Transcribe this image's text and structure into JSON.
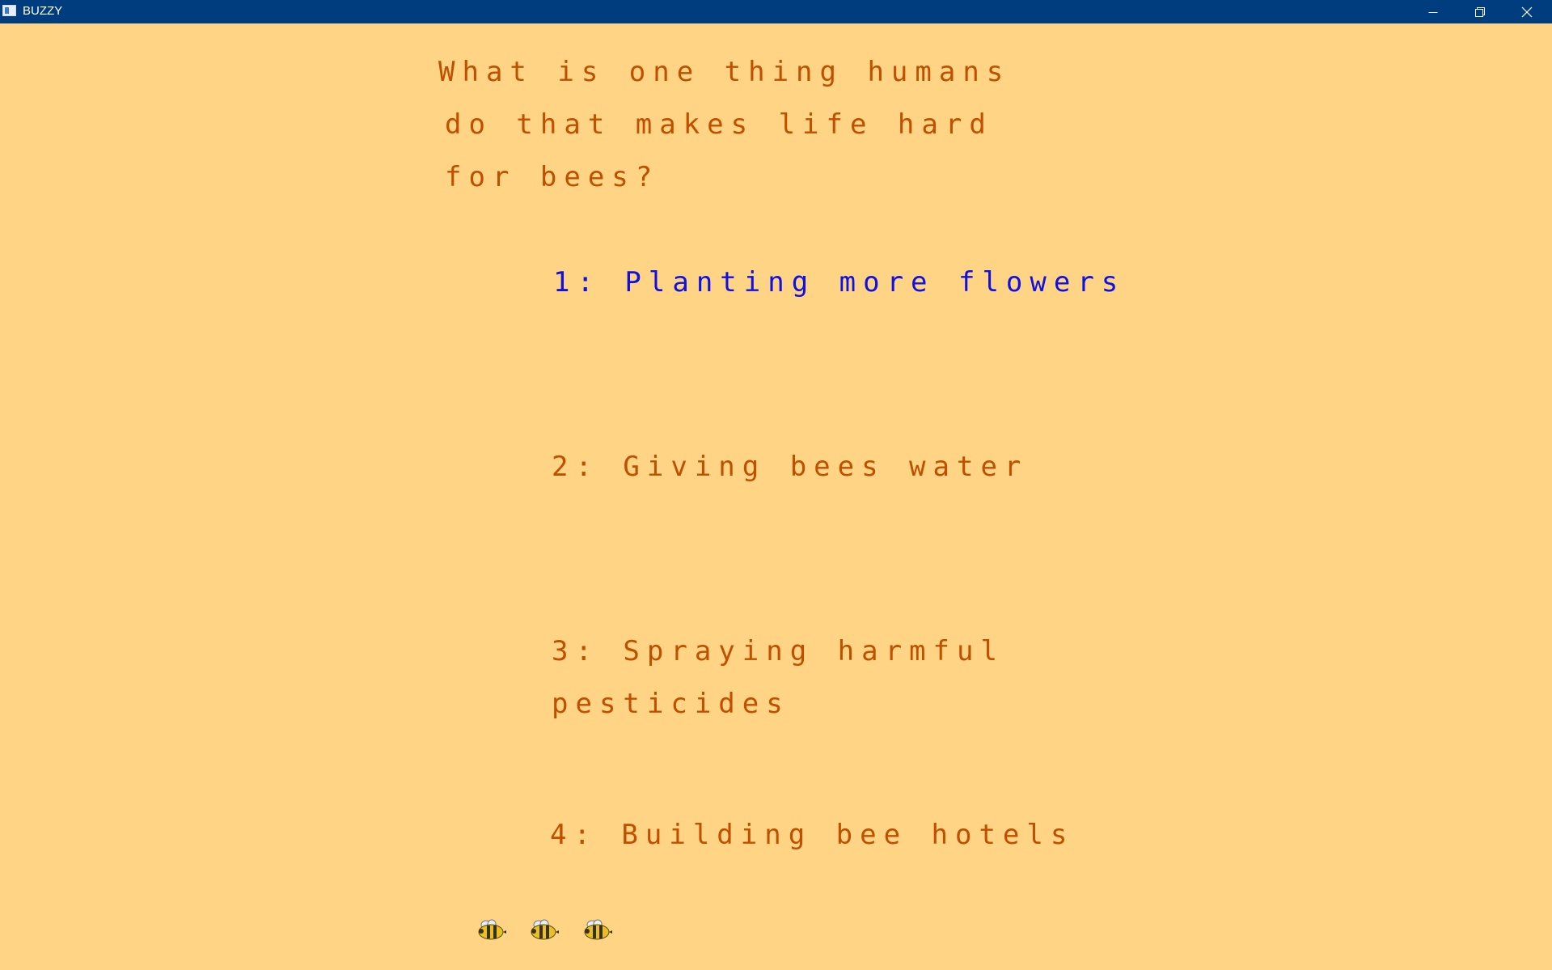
{
  "window": {
    "title": "BUZZY",
    "icons": {
      "app": "app-window-icon",
      "minimize": "minimize-icon",
      "restore": "restore-icon",
      "close": "close-icon"
    }
  },
  "quiz": {
    "question_lines": [
      "What is one thing humans",
      "do that makes life hard",
      "for bees?"
    ],
    "answers": [
      {
        "lines": [
          "1: Planting more flowers"
        ],
        "highlighted": true
      },
      {
        "lines": [
          "2: Giving bees water"
        ],
        "highlighted": false
      },
      {
        "lines": [
          "3: Spraying harmful",
          "pesticides"
        ],
        "highlighted": false
      },
      {
        "lines": [
          "4: Building bee hotels"
        ],
        "highlighted": false
      }
    ],
    "lives_remaining": 3,
    "lives_icon": "bee-icon"
  },
  "colors": {
    "background": "#ffd485",
    "titlebar": "#003d7f",
    "text": "#c05000",
    "highlight": "#1010e0"
  }
}
